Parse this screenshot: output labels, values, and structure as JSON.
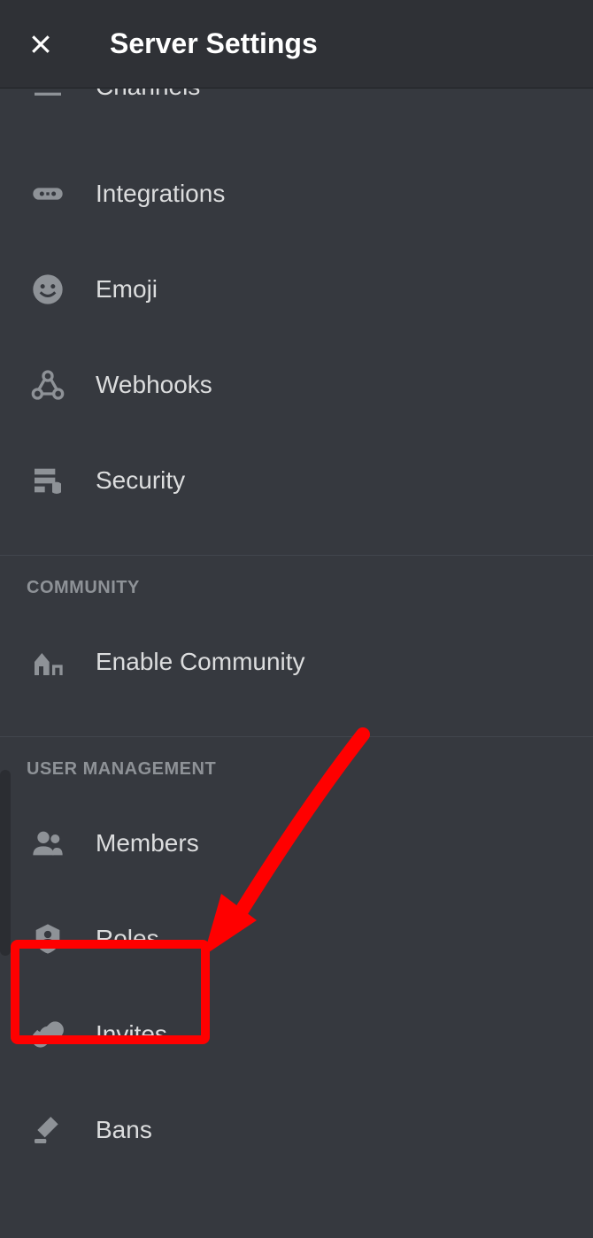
{
  "header": {
    "title": "Server Settings"
  },
  "sections": {
    "general": {
      "items": [
        {
          "label": "Channels",
          "icon": "channels-icon"
        },
        {
          "label": "Integrations",
          "icon": "integrations-icon"
        },
        {
          "label": "Emoji",
          "icon": "emoji-icon"
        },
        {
          "label": "Webhooks",
          "icon": "webhooks-icon"
        },
        {
          "label": "Security",
          "icon": "security-icon"
        }
      ]
    },
    "community": {
      "header": "COMMUNITY",
      "items": [
        {
          "label": "Enable Community",
          "icon": "community-icon"
        }
      ]
    },
    "user_management": {
      "header": "USER MANAGEMENT",
      "items": [
        {
          "label": "Members",
          "icon": "members-icon"
        },
        {
          "label": "Roles",
          "icon": "roles-icon"
        },
        {
          "label": "Invites",
          "icon": "invites-icon"
        },
        {
          "label": "Bans",
          "icon": "bans-icon"
        }
      ]
    }
  },
  "annotation": {
    "highlighted_item": "Roles"
  }
}
